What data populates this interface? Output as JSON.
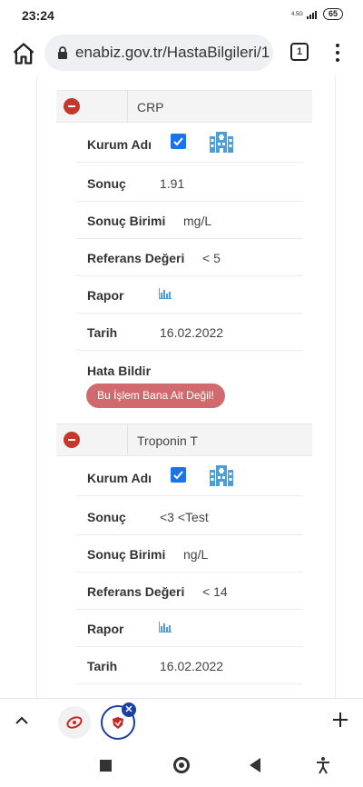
{
  "status_bar": {
    "time": "23:24",
    "network": "4.5G",
    "battery": "65"
  },
  "browser": {
    "url": "enabiz.gov.tr/HastaBilgileri/1",
    "tab_count": "1"
  },
  "tests": [
    {
      "name": "CRP",
      "kurum_label": "Kurum Adı",
      "sonuc_label": "Sonuç",
      "sonuc_value": "1.91",
      "birim_label": "Sonuç Birimi",
      "birim_value": "mg/L",
      "referans_label": "Referans Değeri",
      "referans_value": "< 5",
      "rapor_label": "Rapor",
      "tarih_label": "Tarih",
      "tarih_value": "16.02.2022",
      "hata_label": "Hata Bildir",
      "hata_button": "Bu İşlem Bana Ait Değil!"
    },
    {
      "name": "Troponin T",
      "kurum_label": "Kurum Adı",
      "sonuc_label": "Sonuç",
      "sonuc_value": "<3 <Test",
      "birim_label": "Sonuç Birimi",
      "birim_value": "ng/L",
      "referans_label": "Referans Değeri",
      "referans_value": "< 14",
      "rapor_label": "Rapor",
      "tarih_label": "Tarih",
      "tarih_value": "16.02.2022"
    }
  ],
  "colors": {
    "checkbox": "#1a73e8",
    "hospital_icon": "#4a9fd8",
    "minus_button": "#c0392b",
    "hata_button": "#d16a6e",
    "active_tab": "#1a3fa0"
  }
}
